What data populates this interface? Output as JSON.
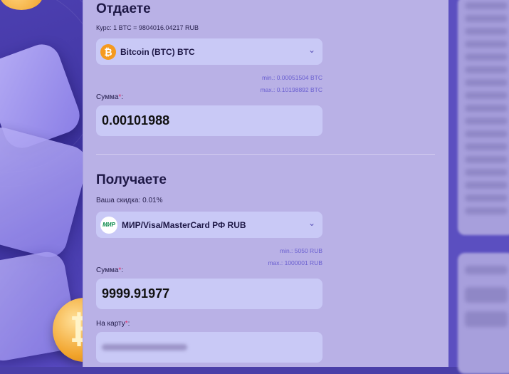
{
  "give": {
    "title": "Отдаете",
    "rate": "Курс: 1 BTC = 9804016.04217 RUB",
    "currency": "Bitcoin (BTC) BTC",
    "min": "min.: 0.00051504 BTC",
    "max": "max.: 0.10198892 BTC",
    "amount_label": "Сумма",
    "amount_value": "0.00101988"
  },
  "receive": {
    "title": "Получаете",
    "discount": "Ваша скидка: 0.01%",
    "currency": "МИР/Visa/MasterCard РФ RUB",
    "min": "min.: 5050 RUB",
    "max": "max.: 1000001 RUB",
    "amount_label": "Сумма",
    "amount_value": "9999.91977",
    "card_label": "На карту"
  },
  "icons": {
    "btc": "bitcoin-icon",
    "mir": "mir-card-icon",
    "chevron": "chevron-down-icon"
  },
  "colors": {
    "panel": "#b9b1e6",
    "field": "#c9c9f6",
    "accent": "#6a5fd0",
    "required": "#e0306a"
  }
}
